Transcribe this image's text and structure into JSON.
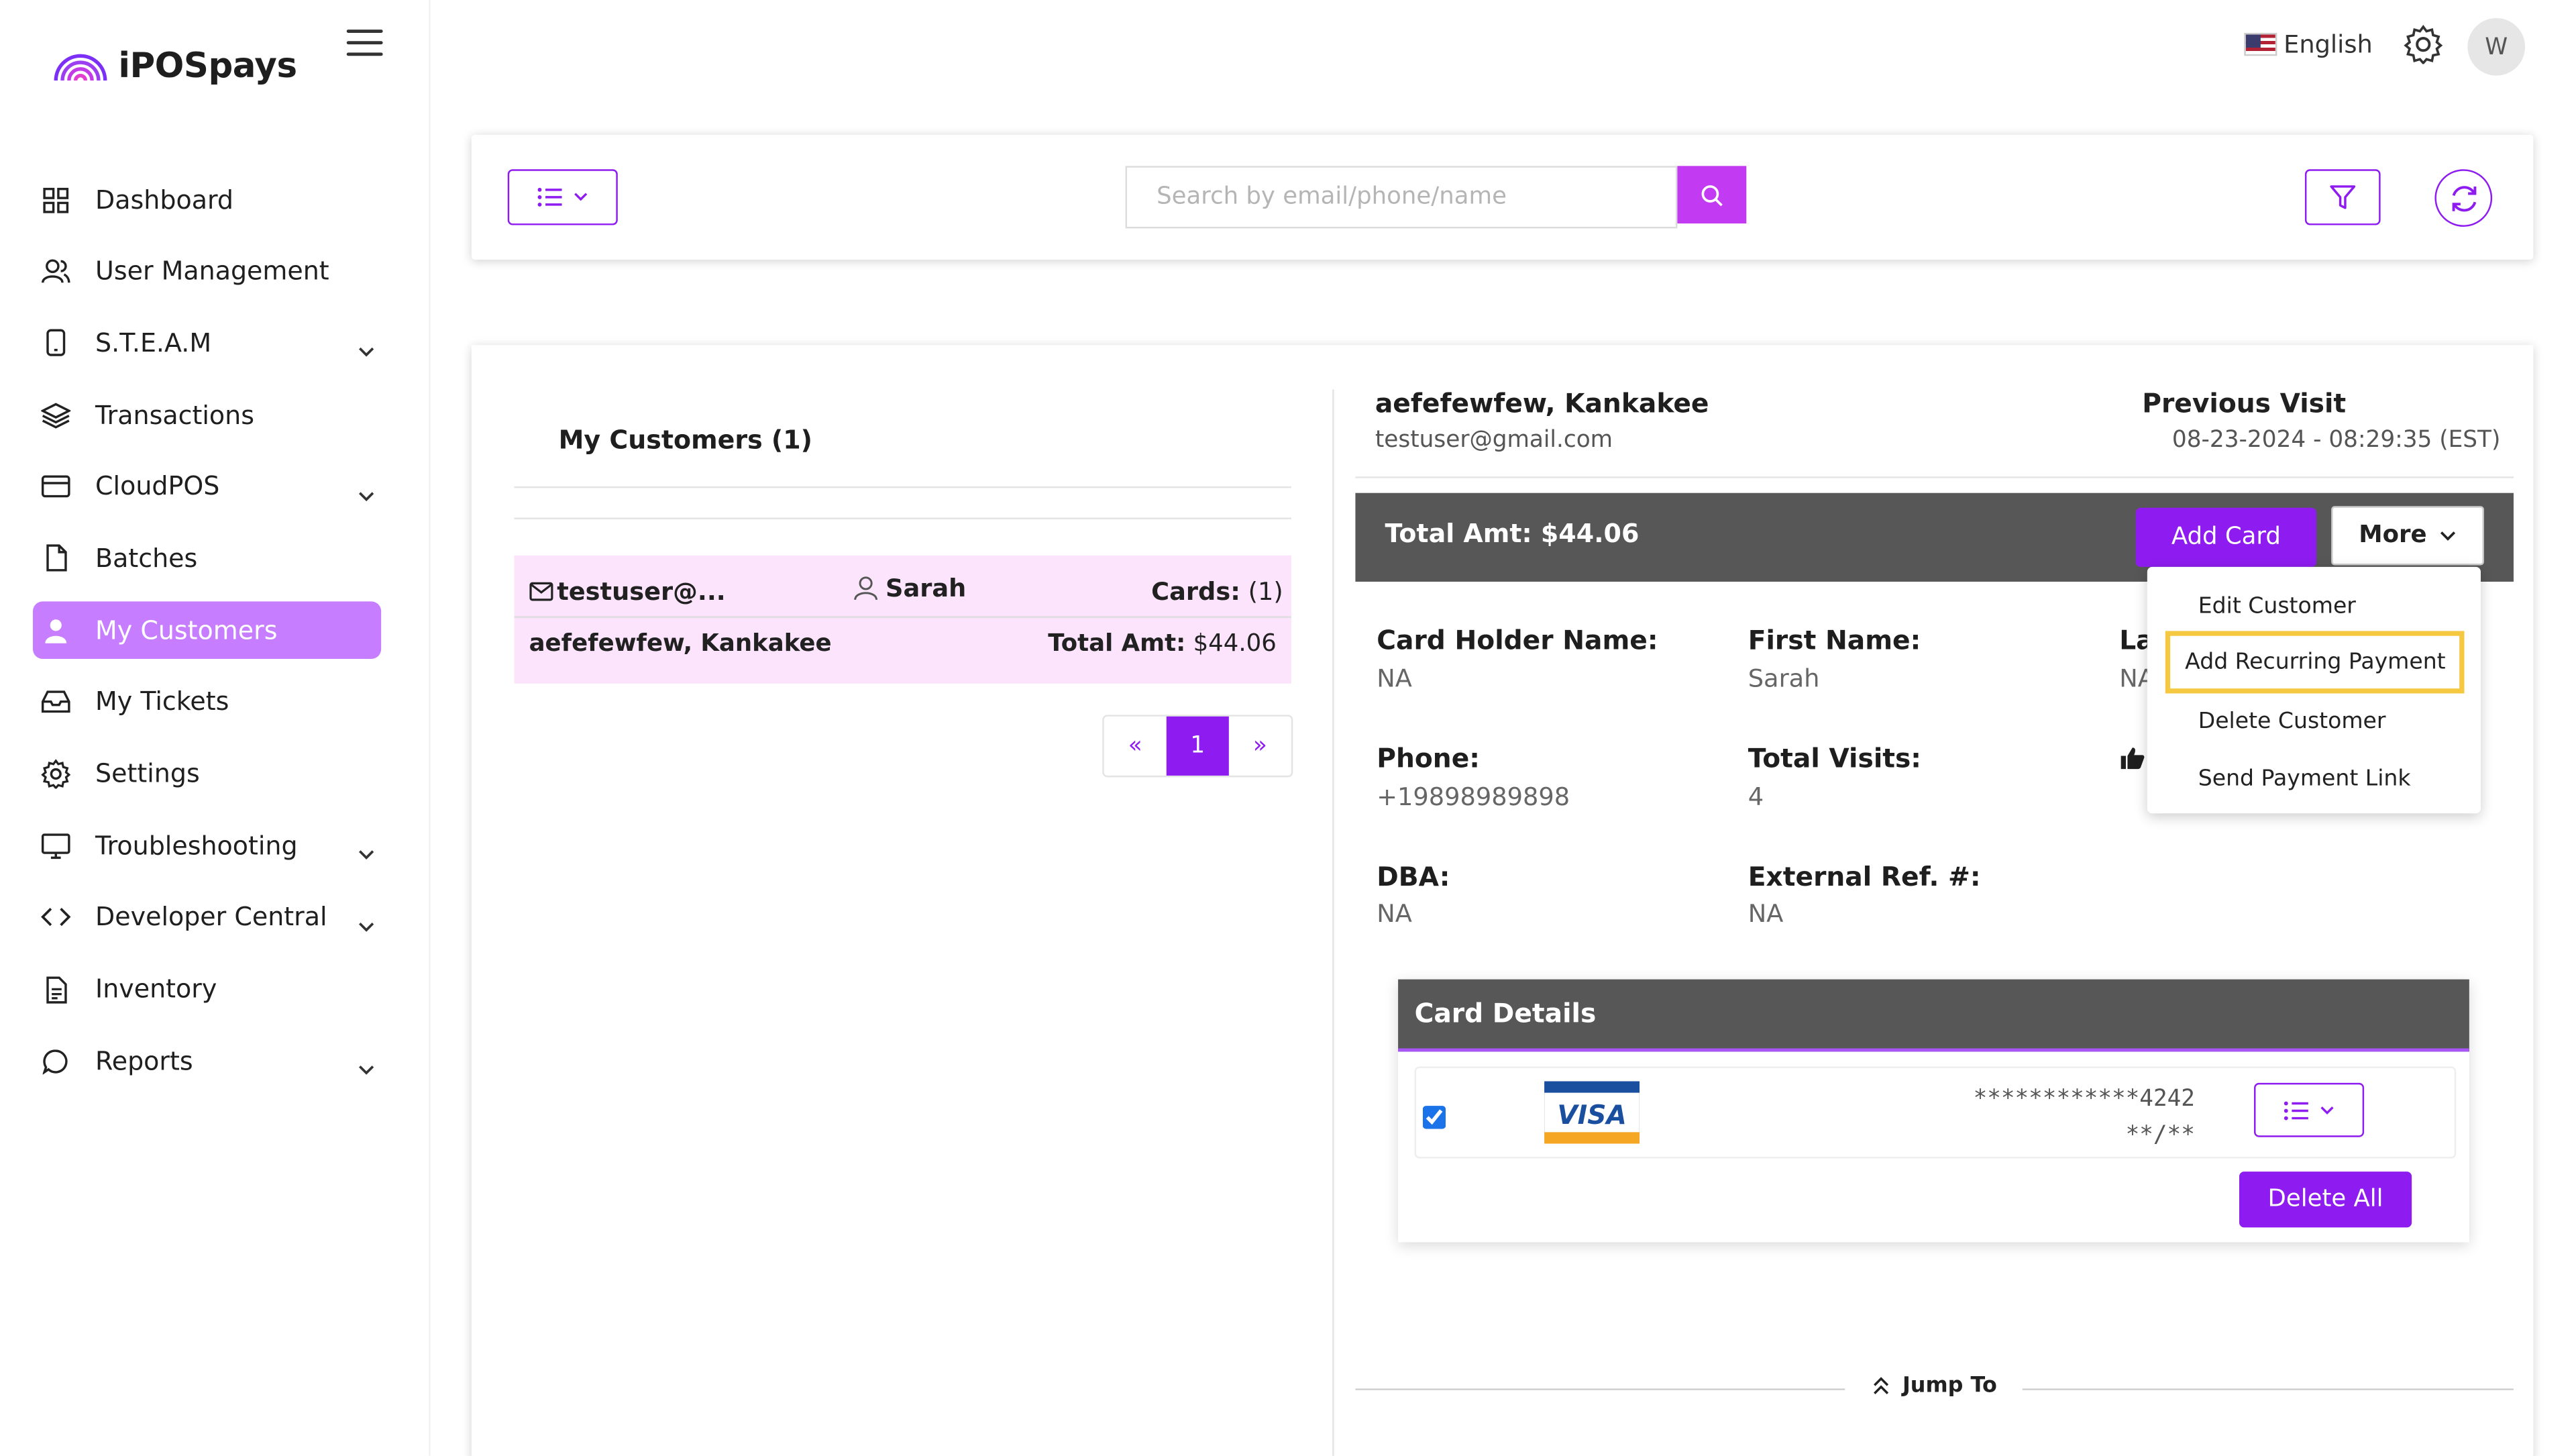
{
  "app": {
    "name": "iPOSpays"
  },
  "topbar": {
    "language": "English",
    "avatar_initial": "W"
  },
  "sidebar": {
    "items": [
      {
        "label": "Dashboard",
        "icon": "grid-icon"
      },
      {
        "label": "User Management",
        "icon": "users-icon"
      },
      {
        "label": "S.T.E.A.M",
        "icon": "tablet-icon"
      },
      {
        "label": "Transactions",
        "icon": "layers-icon"
      },
      {
        "label": "CloudPOS",
        "icon": "credit-card-icon"
      },
      {
        "label": "Batches",
        "icon": "file-icon"
      },
      {
        "label": "My Customers",
        "icon": "user-icon"
      },
      {
        "label": "My Tickets",
        "icon": "inbox-icon"
      },
      {
        "label": "Settings",
        "icon": "gear-icon"
      },
      {
        "label": "Troubleshooting",
        "icon": "monitor-icon"
      },
      {
        "label": "Developer Central",
        "icon": "code-icon"
      },
      {
        "label": "Inventory",
        "icon": "document-icon"
      },
      {
        "label": "Reports",
        "icon": "chat-icon"
      }
    ]
  },
  "search": {
    "placeholder": "Search by email/phone/name"
  },
  "list": {
    "title": "My Customers (1)",
    "customer": {
      "email": "testuser@...",
      "first_name": "Sarah",
      "cards_label": "Cards:",
      "cards_count": "(1)",
      "name": "aefefewfew, Kankakee",
      "total_label": "Total Amt:",
      "total_value": "$44.06"
    },
    "pager": {
      "prev": "«",
      "page": "1",
      "next": "»"
    }
  },
  "detail": {
    "name": "aefefewfew, Kankakee",
    "email": "testuser@gmail.com",
    "previous_visit_label": "Previous Visit",
    "previous_visit_value": "08-23-2024 - 08:29:35 (EST)",
    "total_amt": "Total Amt: $44.06",
    "add_card": "Add Card",
    "more": "More",
    "fields": {
      "card_holder_label": "Card Holder Name:",
      "card_holder_value": "NA",
      "first_name_label": "First Name:",
      "first_name_value": "Sarah",
      "last_name_label": "La",
      "last_name_value": "NA",
      "phone_label": "Phone:",
      "phone_value": "+19898989898",
      "total_visits_label": "Total Visits:",
      "total_visits_value": "4",
      "dba_label": "DBA:",
      "dba_value": "NA",
      "ext_ref_label": "External Ref. #:",
      "ext_ref_value": "NA"
    },
    "more_menu": [
      "Edit Customer",
      "Add Recurring Payment",
      "Delete Customer",
      "Send Payment Link"
    ],
    "card_details": {
      "title": "Card Details",
      "brand": "VISA",
      "number": "************4242",
      "expiry": "**/**",
      "delete_all": "Delete All"
    },
    "jump_to": "Jump To"
  },
  "colors": {
    "accent": "#8e1cf0",
    "active_nav": "#c77dff",
    "dark_bar": "#575757",
    "highlight": "#f5c842"
  }
}
